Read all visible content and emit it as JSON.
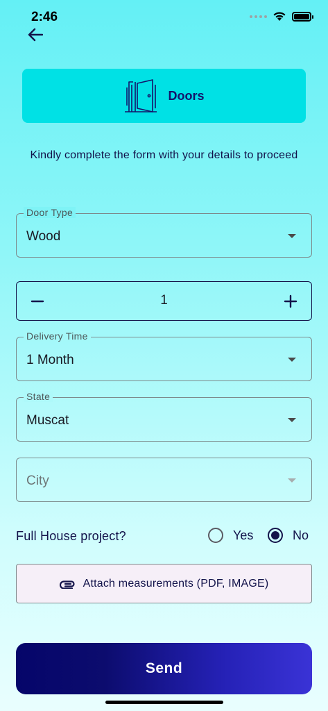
{
  "status_bar": {
    "time": "2:46"
  },
  "header": {
    "title": "Doors",
    "icon": "door-icon"
  },
  "intro_text": "Kindly complete the form with your details to proceed",
  "form": {
    "door_type": {
      "label": "Door Type",
      "value": "Wood"
    },
    "quantity": {
      "value": "1"
    },
    "delivery_time": {
      "label": "Delivery Time",
      "value": "1 Month"
    },
    "state": {
      "label": "State",
      "value": "Muscat"
    },
    "city": {
      "placeholder": "City"
    },
    "full_house": {
      "question": "Full House project?",
      "options": [
        "Yes",
        "No"
      ],
      "selected": "No"
    },
    "attach": {
      "label": "Attach measurements (PDF, IMAGE)",
      "icon": "paperclip-icon"
    }
  },
  "send_button": {
    "label": "Send"
  },
  "colors": {
    "header_card": "#00e1e5",
    "primary_dark": "#14144a",
    "send_gradient_start": "#05056a",
    "send_gradient_end": "#3a33d6"
  }
}
